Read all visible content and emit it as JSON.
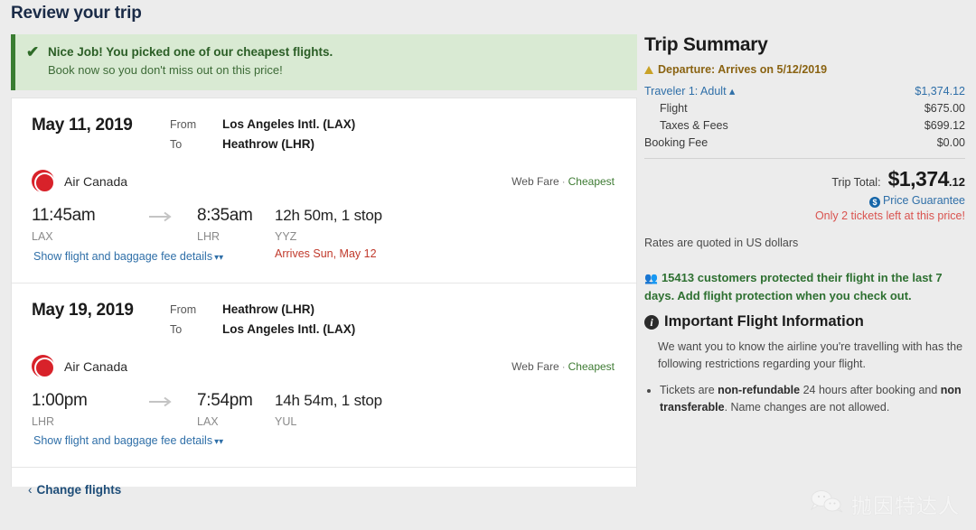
{
  "page": {
    "title": "Review your trip"
  },
  "alert": {
    "icon": "check-icon",
    "title": "Nice Job! You picked one of our cheapest flights.",
    "subtitle": "Book now so you don't miss out on this price!",
    "bg_color": "#d9ead3",
    "border_color": "#3a7d32"
  },
  "legs": [
    {
      "date": "May 11, 2019",
      "from_label": "From",
      "to_label": "To",
      "from_airport": "Los Angeles Intl. (LAX)",
      "to_airport": "Heathrow (LHR)",
      "airline": "Air Canada",
      "fare_type": "Web Fare",
      "fare_separator": "·",
      "fare_badge": "Cheapest",
      "depart_time": "11:45am",
      "depart_code": "LAX",
      "arrive_time": "8:35am",
      "arrive_code": "LHR",
      "duration": "12h 50m, 1 stop",
      "stop_code": "YYZ",
      "arrives_note": "Arrives Sun, May 12",
      "details_link": "Show flight and baggage fee details"
    },
    {
      "date": "May 19, 2019",
      "from_label": "From",
      "to_label": "To",
      "from_airport": "Heathrow (LHR)",
      "to_airport": "Los Angeles Intl. (LAX)",
      "airline": "Air Canada",
      "fare_type": "Web Fare",
      "fare_separator": "·",
      "fare_badge": "Cheapest",
      "depart_time": "1:00pm",
      "depart_code": "LHR",
      "arrive_time": "7:54pm",
      "arrive_code": "LAX",
      "duration": "14h 54m, 1 stop",
      "stop_code": "YUL",
      "arrives_note": "",
      "details_link": "Show flight and baggage fee details"
    }
  ],
  "footer": {
    "change_flights": "Change flights",
    "back_chevron": "‹"
  },
  "summary": {
    "title": "Trip Summary",
    "departure_warning": "Departure: Arrives on 5/12/2019",
    "rows": [
      {
        "label": "Traveler 1: Adult",
        "value": "$1,374.12",
        "style": "traveler",
        "toggle_icon": "chevron-up-icon"
      },
      {
        "label": "Flight",
        "value": "$675.00",
        "style": "indent"
      },
      {
        "label": "Taxes & Fees",
        "value": "$699.12",
        "style": "indent"
      },
      {
        "label": "Booking Fee",
        "value": "$0.00",
        "style": "normal"
      }
    ],
    "trip_total_label": "Trip Total:",
    "trip_total_amount": "$1,374",
    "trip_total_cents": ".12",
    "price_guarantee": "Price Guarantee",
    "price_guarantee_icon": "dollar-circle-icon",
    "tickets_left": "Only 2 tickets left at this price!",
    "rates_note": "Rates are quoted in US dollars",
    "protection_note": "15413 customers protected their flight in the last 7 days. Add flight protection when you check out.",
    "protection_icon": "people-icon"
  },
  "important": {
    "heading": "Important Flight Information",
    "heading_icon": "info-icon",
    "intro": "We want you to know the airline you're travelling with has the following restrictions regarding your flight.",
    "bullets": [
      {
        "part1": "Tickets are ",
        "bold1": "non-refundable",
        "part2": " 24 hours after booking and ",
        "bold2": "non transferable",
        "part3": ". Name changes are not allowed."
      }
    ]
  },
  "watermark": {
    "text": "抛因特达人",
    "icon": "chat-bubbles-icon"
  }
}
